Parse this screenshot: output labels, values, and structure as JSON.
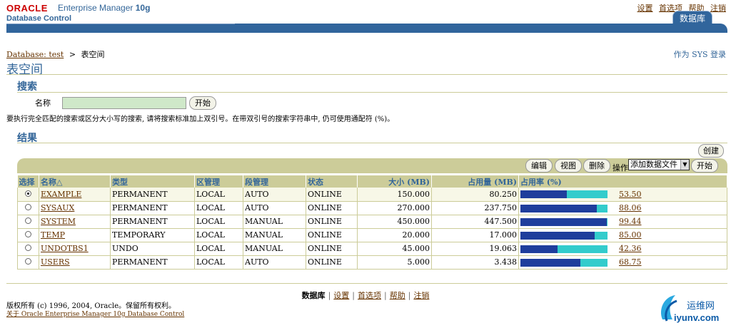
{
  "header": {
    "oracle": "ORACLE",
    "product": "Enterprise Manager ",
    "version": "10g",
    "subtitle": "Database Control",
    "links": [
      "设置",
      "首选项",
      "帮助",
      "注销"
    ],
    "tab": "数据库"
  },
  "breadcrumb": {
    "parent": "Database: test",
    "separator": ">",
    "current": "表空间"
  },
  "login_as": "作为 SYS 登录",
  "page_title": "表空间",
  "search": {
    "title": "搜索",
    "name_label": "名称",
    "name_value": "",
    "go_button": "开始",
    "hint": "要执行完全匹配的搜索或区分大小写的搜索, 请将搜索标准加上双引号。在带双引号的搜索字符串中, 仍可使用通配符 (%)。"
  },
  "results": {
    "title": "结果",
    "create_button": "创建",
    "edit_button": "编辑",
    "view_button": "视图",
    "delete_button": "删除",
    "actions_label": "操作",
    "actions_selected": "添加数据文件",
    "go_button": "开始",
    "columns": [
      "选择",
      "名称",
      "类型",
      "区管理",
      "段管理",
      "状态",
      "大小 (MB)",
      "占用量 (MB)",
      "占用率 (%)"
    ],
    "sort_indicator": "△",
    "rows": [
      {
        "name": "EXAMPLE",
        "type": "PERMANENT",
        "extent": "LOCAL",
        "segment": "AUTO",
        "status": "ONLINE",
        "size": "150.000",
        "used": "80.250",
        "pct": "53.50",
        "pct_value": 53.5,
        "selected": true
      },
      {
        "name": "SYSAUX",
        "type": "PERMANENT",
        "extent": "LOCAL",
        "segment": "AUTO",
        "status": "ONLINE",
        "size": "270.000",
        "used": "237.750",
        "pct": "88.06",
        "pct_value": 88.06,
        "selected": false
      },
      {
        "name": "SYSTEM",
        "type": "PERMANENT",
        "extent": "LOCAL",
        "segment": "MANUAL",
        "status": "ONLINE",
        "size": "450.000",
        "used": "447.500",
        "pct": "99.44",
        "pct_value": 99.44,
        "selected": false
      },
      {
        "name": "TEMP",
        "type": "TEMPORARY",
        "extent": "LOCAL",
        "segment": "MANUAL",
        "status": "ONLINE",
        "size": "20.000",
        "used": "17.000",
        "pct": "85.00",
        "pct_value": 85.0,
        "selected": false
      },
      {
        "name": "UNDOTBS1",
        "type": "UNDO",
        "extent": "LOCAL",
        "segment": "MANUAL",
        "status": "ONLINE",
        "size": "45.000",
        "used": "19.063",
        "pct": "42.36",
        "pct_value": 42.36,
        "selected": false
      },
      {
        "name": "USERS",
        "type": "PERMANENT",
        "extent": "LOCAL",
        "segment": "AUTO",
        "status": "ONLINE",
        "size": "5.000",
        "used": "3.438",
        "pct": "68.75",
        "pct_value": 68.75,
        "selected": false
      }
    ]
  },
  "footer": {
    "current": "数据库",
    "links": [
      "设置",
      "首选项",
      "帮助",
      "注销"
    ],
    "separator": "|",
    "copyright": "版权所有 (c) 1996, 2004, Oracle。保留所有权利。",
    "about": "关于 Oracle Enterprise Manager 10g Database Control"
  },
  "watermark": {
    "text": "运维网",
    "site": "iyunv.com"
  },
  "colors": {
    "brand_blue": "#31659c",
    "tan": "#cccc99",
    "bar_fill": "#1f3e9c",
    "bar_bg": "#33cccc",
    "link": "#663300"
  }
}
